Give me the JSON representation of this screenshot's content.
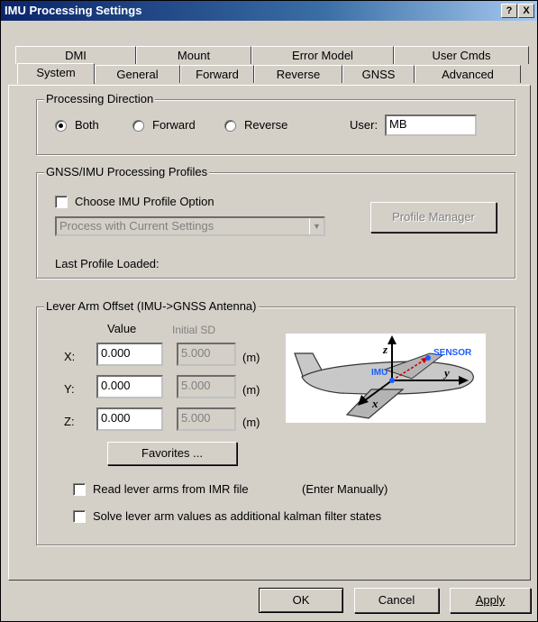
{
  "window": {
    "title": "IMU Processing Settings",
    "help_btn": "?",
    "close_btn": "X"
  },
  "tabs_back": [
    "DMI",
    "Mount",
    "Error Model",
    "User Cmds"
  ],
  "tabs_front": [
    "System",
    "General",
    "Forward",
    "Reverse",
    "GNSS",
    "Advanced"
  ],
  "processing_direction": {
    "title": "Processing Direction",
    "options": [
      "Both",
      "Forward",
      "Reverse"
    ],
    "selected": "Both",
    "user_label": "User:",
    "user_value": "MB"
  },
  "profiles": {
    "title": "GNSS/IMU Processing Profiles",
    "choose_label": "Choose IMU Profile Option",
    "select_value": "Process with Current Settings",
    "manager_btn": "Profile Manager",
    "last_loaded": "Last Profile Loaded:"
  },
  "lever_arm": {
    "title": "Lever Arm Offset (IMU->GNSS Antenna)",
    "value_header": "Value",
    "sd_header": "Initial SD",
    "rows": [
      {
        "label": "X:",
        "value": "0.000",
        "sd": "5.000",
        "unit": "(m)"
      },
      {
        "label": "Y:",
        "value": "0.000",
        "sd": "5.000",
        "unit": "(m)"
      },
      {
        "label": "Z:",
        "value": "0.000",
        "sd": "5.000",
        "unit": "(m)"
      }
    ],
    "favorites_btn": "Favorites ...",
    "read_imr_label": "Read lever arms from IMR file",
    "enter_manually": "(Enter Manually)",
    "solve_label": "Solve lever arm values as additional kalman filter states",
    "diagram": {
      "z": "z",
      "x": "x",
      "y": "y",
      "sensor": "SENSOR",
      "imu": "IMU"
    }
  },
  "buttons": {
    "ok": "OK",
    "cancel": "Cancel",
    "apply": "Apply"
  },
  "colors": {
    "face": "#d4d0c8",
    "title_start": "#0a246a",
    "sensor_blue": "#1a5cff",
    "arrow_red": "#cc0000"
  }
}
